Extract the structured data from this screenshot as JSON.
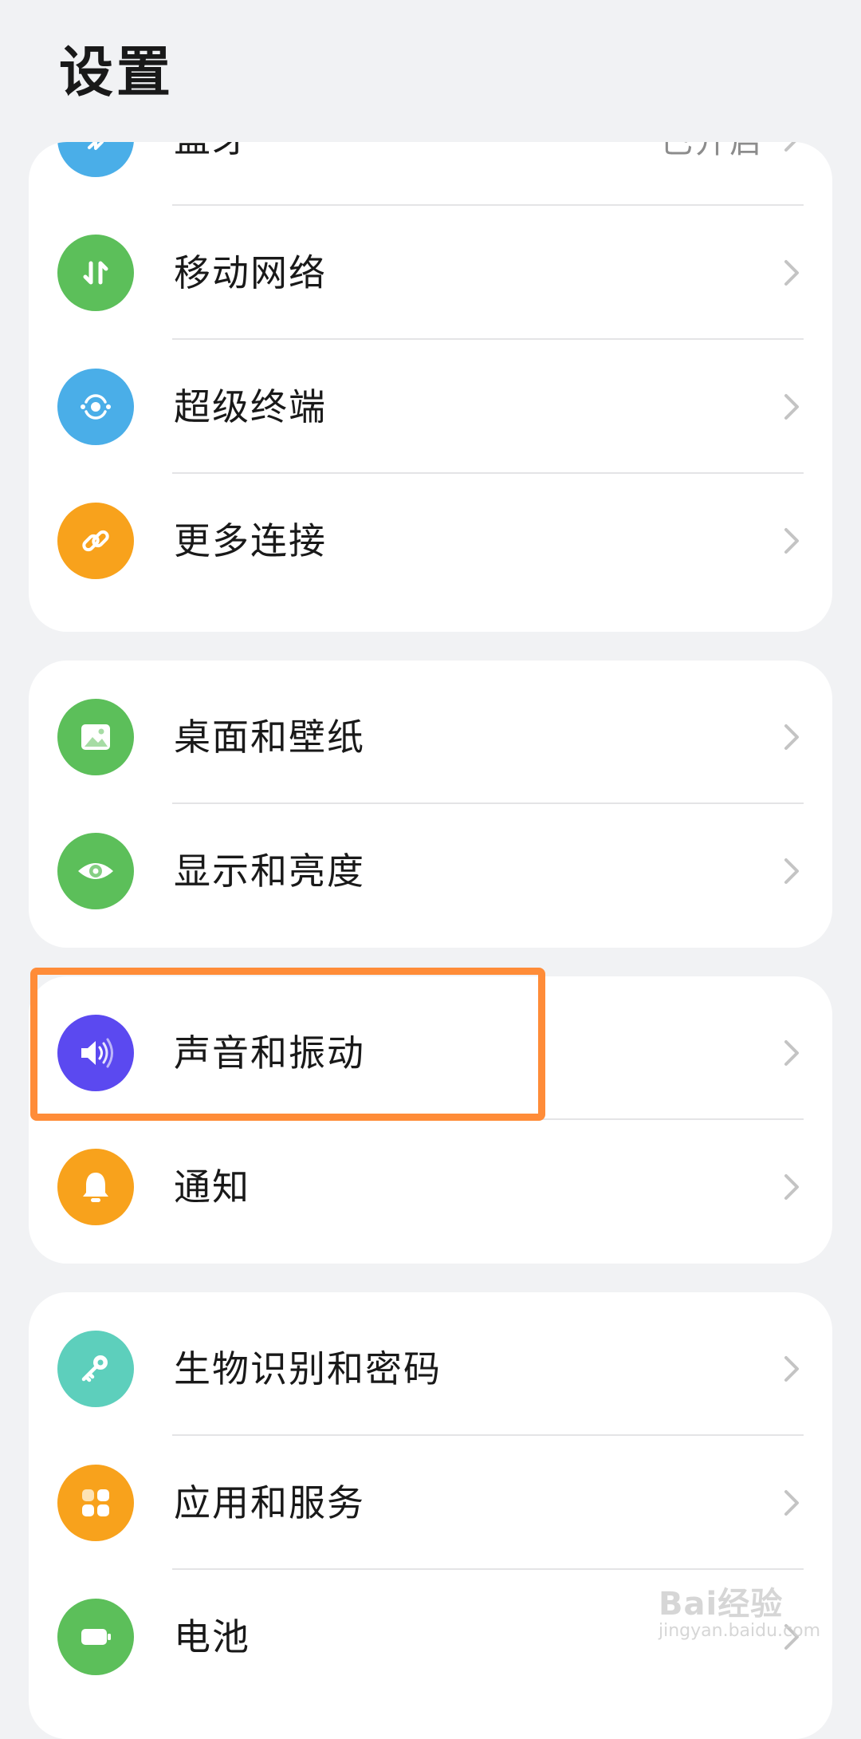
{
  "page": {
    "title": "设置"
  },
  "colors": {
    "bluetooth": "#4aaee8",
    "mobile_network": "#5cbf5a",
    "super_terminal": "#4aaee8",
    "more_connections": "#f8a21c",
    "desktop_wallpaper": "#5cbf5a",
    "display_brightness": "#5cbf5a",
    "sound_vibration": "#5b49f0",
    "notifications": "#f8a21c",
    "biometrics_password": "#5dcfbc",
    "apps_services": "#f8a21c",
    "battery": "#5cbf5a",
    "highlight": "#ff8c38"
  },
  "groups": [
    {
      "items": [
        {
          "label": "蓝牙",
          "value": "已开启",
          "icon": "bluetooth-icon"
        },
        {
          "label": "移动网络",
          "icon": "mobile-data-icon"
        },
        {
          "label": "超级终端",
          "icon": "super-terminal-icon"
        },
        {
          "label": "更多连接",
          "icon": "link-icon"
        }
      ]
    },
    {
      "items": [
        {
          "label": "桌面和壁纸",
          "icon": "image-icon"
        },
        {
          "label": "显示和亮度",
          "icon": "eye-icon"
        }
      ]
    },
    {
      "items": [
        {
          "label": "声音和振动",
          "icon": "speaker-icon"
        },
        {
          "label": "通知",
          "icon": "bell-icon"
        }
      ]
    },
    {
      "items": [
        {
          "label": "生物识别和密码",
          "icon": "key-icon"
        },
        {
          "label": "应用和服务",
          "icon": "apps-icon"
        },
        {
          "label": "电池",
          "icon": "battery-icon"
        }
      ]
    }
  ],
  "watermark": {
    "brand": "Bai经验",
    "url": "jingyan.baidu.com"
  }
}
